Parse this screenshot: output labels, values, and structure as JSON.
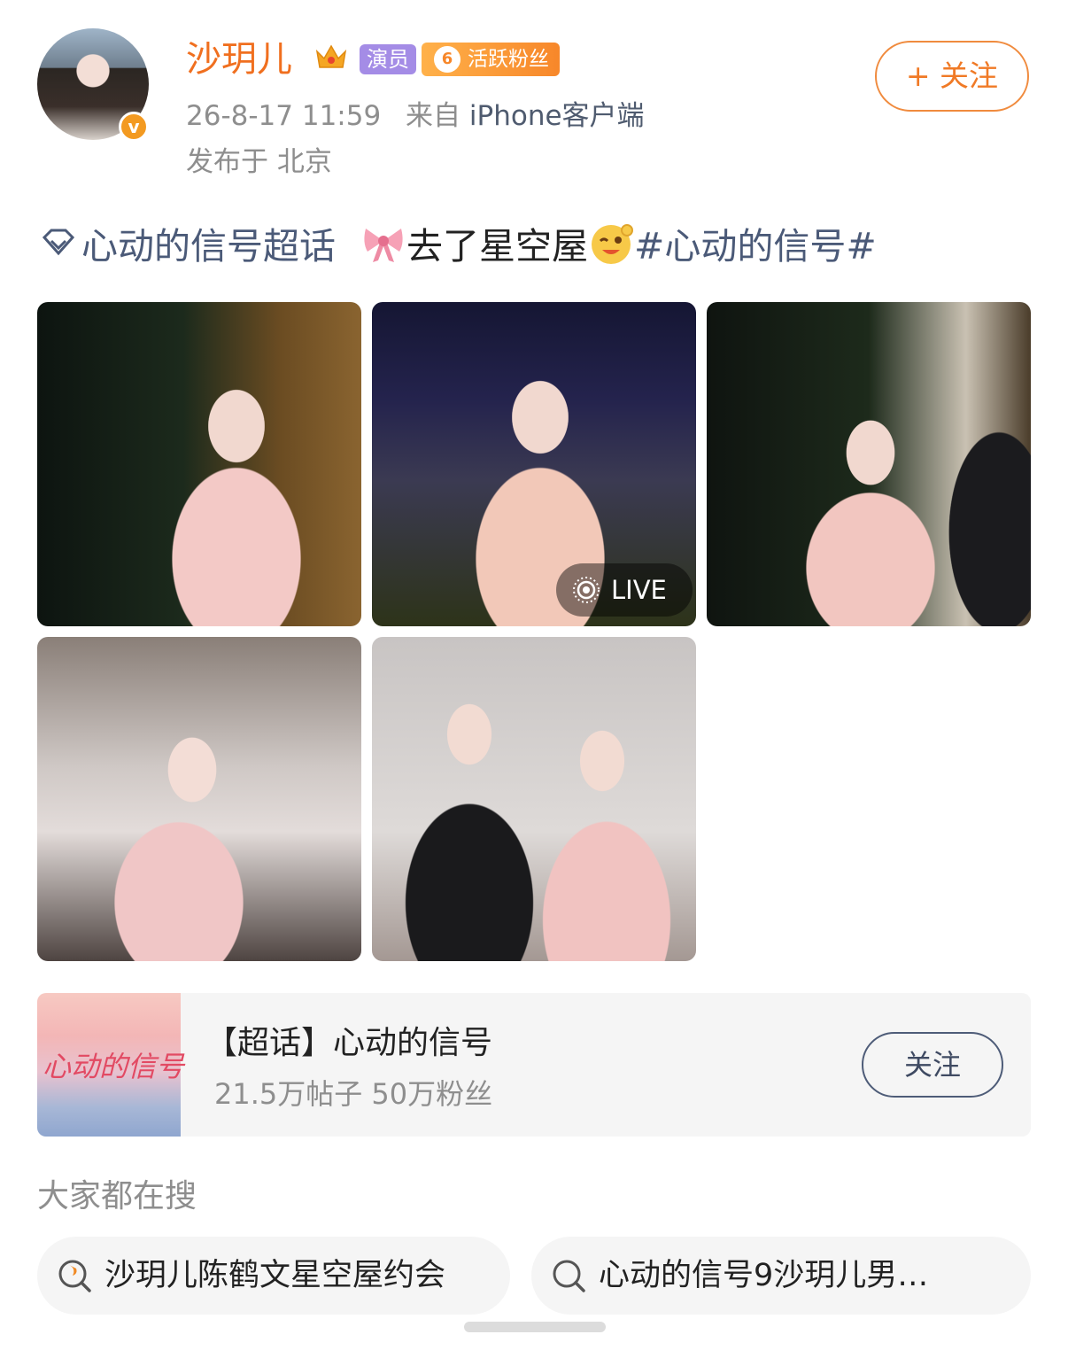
{
  "header": {
    "username": "沙玥儿",
    "actor_tag": "演员",
    "fan_level": "6",
    "fan_tag": "活跃粉丝",
    "timestamp": "26-8-17 11:59",
    "source_prefix": "来自",
    "source": "iPhone客户端",
    "location": "发布于 北京",
    "follow_label": "+ 关注",
    "verified_mark": "v"
  },
  "post": {
    "topic": "心动的信号超话",
    "text": "去了星空屋",
    "hashtag": "#心动的信号#"
  },
  "photos": {
    "count": 5,
    "live_label": "LIVE"
  },
  "super_topic_card": {
    "thumb_text": "心动的信号",
    "title": "【超话】心动的信号",
    "stats": "21.5万帖子 50万粉丝",
    "follow_label": "关注"
  },
  "search_section": {
    "heading": "大家都在搜",
    "chips": [
      {
        "label": "沙玥儿陈鹤文星空屋约会",
        "icon": "hot-search-icon"
      },
      {
        "label": "心动的信号9沙玥儿男…",
        "icon": "search-icon"
      }
    ]
  },
  "colors": {
    "username": "#f06f1f",
    "link": "#4b5a78",
    "meta": "#8e8e8e",
    "follow_border": "#f08b3e"
  }
}
